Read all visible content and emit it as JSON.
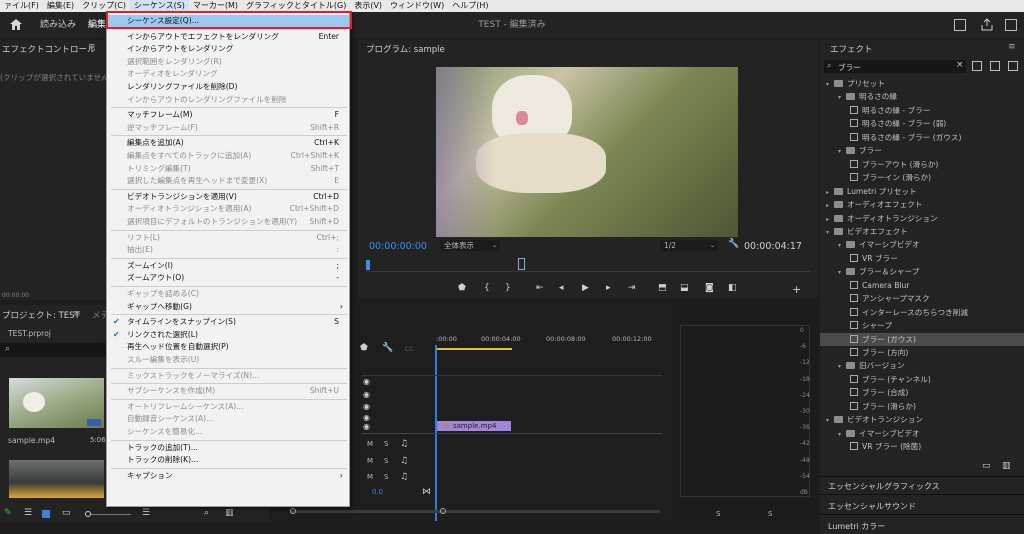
{
  "menubar": {
    "items": [
      "ァイル(F)",
      "編集(E)",
      "クリップ(C)",
      "シーケンス(S)",
      "マーカー(M)",
      "グラフィックとタイトル(G)",
      "表示(V)",
      "ウィンドウ(W)",
      "ヘルプ(H)"
    ]
  },
  "header": {
    "tabs": [
      "読み込み",
      "編集"
    ],
    "title": "TEST - 編集済み"
  },
  "effect_controls": {
    "title": "エフェクトコントロール",
    "empty": "(クリップが選択されていません)",
    "time": "00:00:00"
  },
  "program": {
    "title": "プログラム: sample",
    "timecode": "00:00:00:00",
    "fit": "全体表示",
    "resolution": "1/2",
    "duration": "00:00:04:17"
  },
  "project": {
    "title": "プロジェクト: TEST",
    "tab2": "メデ",
    "file": "TEST.prproj",
    "clip_name": "sample.mp4",
    "clip_duration": "5:06"
  },
  "timeline": {
    "ruler": [
      ":00:00",
      "00:00:04:00",
      "00:00:08:00",
      "00:00:12:00"
    ],
    "clip_label": "sample.mp4",
    "volume": "0.0"
  },
  "meter": {
    "ticks": [
      "0",
      "-6",
      "-12",
      "-18",
      "-24",
      "-30",
      "-36",
      "-42",
      "-48",
      "-54",
      "dB"
    ],
    "solo": [
      "S",
      "S"
    ]
  },
  "effects": {
    "title": "エフェクト",
    "search": "ブラー",
    "tree": [
      {
        "label": "プリセット",
        "type": "folder",
        "level": 0,
        "open": true
      },
      {
        "label": "明るさの縁",
        "type": "folder",
        "level": 1,
        "open": true
      },
      {
        "label": "明るさの縁 - ブラー",
        "type": "fx",
        "level": 2
      },
      {
        "label": "明るさの縁 - ブラー (弱)",
        "type": "fx",
        "level": 2
      },
      {
        "label": "明るさの縁 - ブラー (ガウス)",
        "type": "fx",
        "level": 2
      },
      {
        "label": "ブラー",
        "type": "folder",
        "level": 1,
        "open": true
      },
      {
        "label": "ブラーアウト (滑らか)",
        "type": "fx",
        "level": 2
      },
      {
        "label": "ブラーイン (滑らか)",
        "type": "fx",
        "level": 2
      },
      {
        "label": "Lumetri プリセット",
        "type": "folder",
        "level": 0,
        "open": false
      },
      {
        "label": "オーディオエフェクト",
        "type": "folder",
        "level": 0,
        "open": false
      },
      {
        "label": "オーディオトランジション",
        "type": "folder",
        "level": 0,
        "open": false
      },
      {
        "label": "ビデオエフェクト",
        "type": "folder",
        "level": 0,
        "open": true
      },
      {
        "label": "イマーシブビデオ",
        "type": "folder",
        "level": 1,
        "open": true
      },
      {
        "label": "VR ブラー",
        "type": "fx",
        "level": 2
      },
      {
        "label": "ブラー＆シャープ",
        "type": "folder",
        "level": 1,
        "open": true
      },
      {
        "label": "Camera Blur",
        "type": "fx",
        "level": 2
      },
      {
        "label": "アンシャープマスク",
        "type": "fx",
        "level": 2
      },
      {
        "label": "インターレースのちらつき削減",
        "type": "fx",
        "level": 2
      },
      {
        "label": "シャープ",
        "type": "fx",
        "level": 2
      },
      {
        "label": "ブラー (ガウス)",
        "type": "fx",
        "level": 2,
        "selected": true
      },
      {
        "label": "ブラー (方向)",
        "type": "fx",
        "level": 2
      },
      {
        "label": "旧バージョン",
        "type": "folder",
        "level": 1,
        "open": true
      },
      {
        "label": "ブラー (チャンネル)",
        "type": "fx",
        "level": 2
      },
      {
        "label": "ブラー (合成)",
        "type": "fx",
        "level": 2
      },
      {
        "label": "ブラー (滑らか)",
        "type": "fx",
        "level": 2
      },
      {
        "label": "ビデオトランジション",
        "type": "folder",
        "level": 0,
        "open": true
      },
      {
        "label": "イマーシブビデオ",
        "type": "folder",
        "level": 1,
        "open": true
      },
      {
        "label": "VR ブラー (除菌)",
        "type": "fx",
        "level": 2
      }
    ],
    "essential_graphics": "エッセンシャルグラフィックス",
    "essential_sound": "エッセンシャルサウンド",
    "lumetri": "Lumetri カラー"
  },
  "sequence_menu": [
    {
      "label": "シーケンス設定(Q)...",
      "shortcut": "",
      "enabled": true,
      "highlighted": true
    },
    {
      "sep": true
    },
    {
      "label": "インからアウトでエフェクトをレンダリング",
      "shortcut": "Enter",
      "enabled": true
    },
    {
      "label": "インからアウトをレンダリング",
      "shortcut": "",
      "enabled": true
    },
    {
      "label": "選択範囲をレンダリング(R)",
      "shortcut": "",
      "enabled": false
    },
    {
      "label": "オーディオをレンダリング",
      "shortcut": "",
      "enabled": false
    },
    {
      "label": "レンダリングファイルを削除(D)",
      "shortcut": "",
      "enabled": true
    },
    {
      "label": "インからアウトのレンダリングファイルを削除",
      "shortcut": "",
      "enabled": false
    },
    {
      "sep": true
    },
    {
      "label": "マッチフレーム(M)",
      "shortcut": "F",
      "enabled": true
    },
    {
      "label": "逆マッチフレーム(F)",
      "shortcut": "Shift+R",
      "enabled": false
    },
    {
      "sep": true
    },
    {
      "label": "編集点を追加(A)",
      "shortcut": "Ctrl+K",
      "enabled": true
    },
    {
      "label": "編集点をすべてのトラックに追加(A)",
      "shortcut": "Ctrl+Shift+K",
      "enabled": false
    },
    {
      "label": "トリミング編集(T)",
      "shortcut": "Shift+T",
      "enabled": false
    },
    {
      "label": "選択した編集点を再生ヘッドまで変更(X)",
      "shortcut": "E",
      "enabled": false
    },
    {
      "sep": true
    },
    {
      "label": "ビデオトランジションを適用(V)",
      "shortcut": "Ctrl+D",
      "enabled": true
    },
    {
      "label": "オーディオトランジションを適用(A)",
      "shortcut": "Ctrl+Shift+D",
      "enabled": false
    },
    {
      "label": "選択項目にデフォルトのトランジションを適用(Y)",
      "shortcut": "Shift+D",
      "enabled": false
    },
    {
      "sep": true
    },
    {
      "label": "リフト(L)",
      "shortcut": "Ctrl+;",
      "enabled": false
    },
    {
      "label": "抽出(E)",
      "shortcut": ":",
      "enabled": false
    },
    {
      "sep": true
    },
    {
      "label": "ズームイン(I)",
      "shortcut": ";",
      "enabled": true
    },
    {
      "label": "ズームアウト(O)",
      "shortcut": "-",
      "enabled": true
    },
    {
      "sep": true
    },
    {
      "label": "ギャップを詰める(C)",
      "shortcut": "",
      "enabled": false
    },
    {
      "label": "ギャップへ移動(G)",
      "shortcut": "",
      "enabled": true,
      "submenu": true
    },
    {
      "sep": true
    },
    {
      "label": "タイムラインをスナップイン(S)",
      "shortcut": "S",
      "enabled": true,
      "checked": true
    },
    {
      "label": "リンクされた選択(L)",
      "shortcut": "",
      "enabled": true,
      "checked": true
    },
    {
      "label": "再生ヘッド位置を自動選択(P)",
      "shortcut": "",
      "enabled": true
    },
    {
      "label": "スルー編集を表示(U)",
      "shortcut": "",
      "enabled": false
    },
    {
      "sep": true
    },
    {
      "label": "ミックストラックをノーマライズ(N)...",
      "shortcut": "",
      "enabled": false
    },
    {
      "sep": true
    },
    {
      "label": "サブシーケンスを作成(M)",
      "shortcut": "Shift+U",
      "enabled": false
    },
    {
      "sep": true
    },
    {
      "label": "オートリフレームシーケンス(A)...",
      "shortcut": "",
      "enabled": false
    },
    {
      "label": "自動録音シーケンス(A)...",
      "shortcut": "",
      "enabled": false
    },
    {
      "label": "シーケンスを簡易化...",
      "shortcut": "",
      "enabled": false
    },
    {
      "sep": true
    },
    {
      "label": "トラックの追加(T)...",
      "shortcut": "",
      "enabled": true
    },
    {
      "label": "トラックの削除(K)...",
      "shortcut": "",
      "enabled": true
    },
    {
      "sep": true
    },
    {
      "label": "キャプション",
      "shortcut": "",
      "enabled": true,
      "submenu": true
    }
  ],
  "icons": {
    "home": "home-icon",
    "search": "search-icon",
    "wrench": "wrench-icon"
  },
  "colors": {
    "highlight": "#99c9f1",
    "callout": "#e1202b",
    "playhead": "#2f7de1",
    "clip": "#9f86d8"
  }
}
